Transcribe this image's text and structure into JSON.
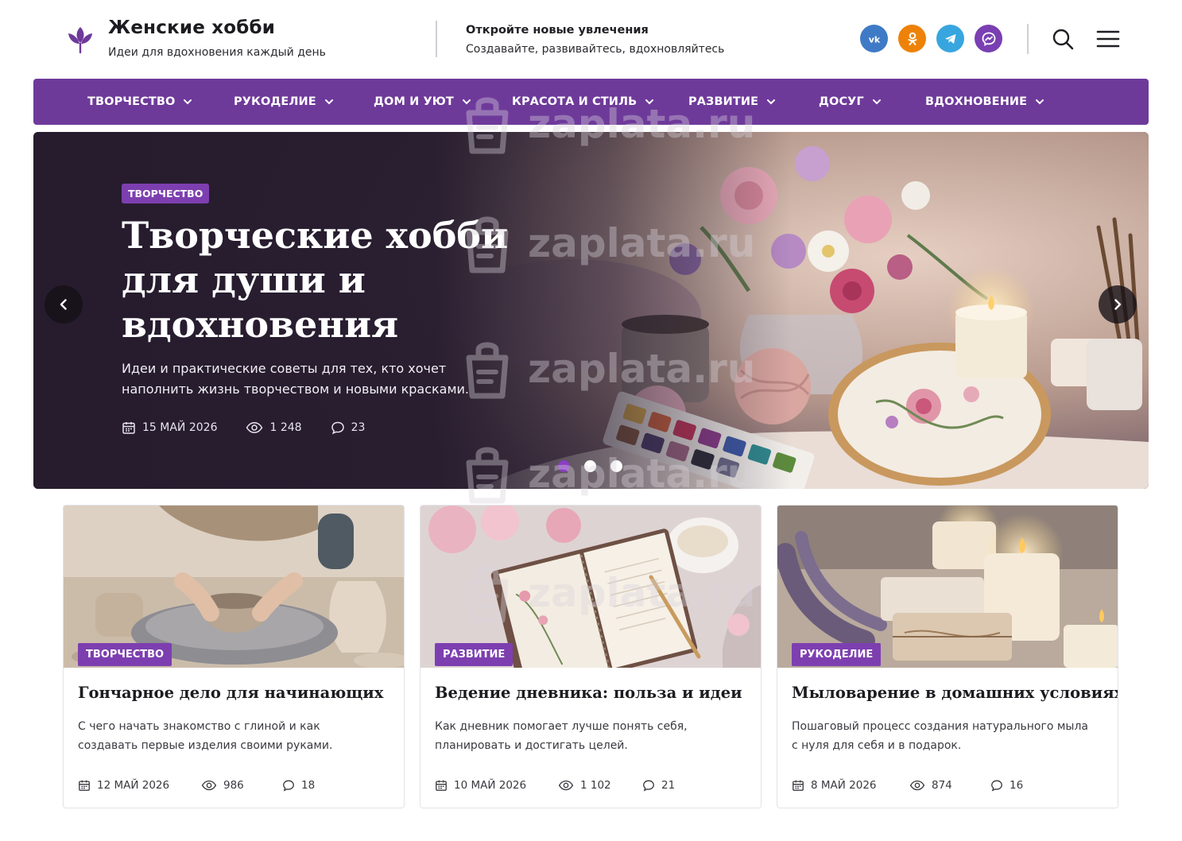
{
  "header": {
    "site_title": "Женские хобби",
    "site_subtitle": "Идеи для вдохновения каждый день",
    "tagline_title": "Откройте новые увлечения",
    "tagline_text": "Создавайте, развивайтесь, вдохновляйтесь",
    "social": [
      "vk-icon",
      "odnoklassniki-icon",
      "telegram-icon",
      "messenger-icon"
    ],
    "brand_color": "#6e3a9a"
  },
  "nav": {
    "items": [
      "ТВОРЧЕСТВО",
      "РУКОДЕЛИЕ",
      "ДОМ И УЮТ",
      "КРАСОТА И СТИЛЬ",
      "РАЗВИТИЕ",
      "ДОСУГ",
      "ВДОХНОВЕНИЕ"
    ]
  },
  "hero": {
    "badge": "ТВОРЧЕСТВО",
    "title": "Творческие хобби для души и вдохновения",
    "text": "Идеи и практические советы для тех, кто хочет наполнить жизнь творчеством и новыми красками.",
    "date": "15 МАЙ 2026",
    "views": "1 248",
    "comments": "23",
    "slides_total": 3,
    "active_slide": 1
  },
  "cards": [
    {
      "badge": "ТВОРЧЕСТВО",
      "title": "Гончарное дело для начинающих",
      "text": "С чего начать знакомство с глиной и как создавать первые изделия своими руками.",
      "date": "12 МАЙ 2026",
      "views": "986",
      "comments": "18"
    },
    {
      "badge": "РАЗВИТИЕ",
      "title": "Ведение дневника: польза и идеи",
      "text": "Как дневник помогает лучше понять себя, планировать и достигать целей.",
      "date": "10 МАЙ 2026",
      "views": "1 102",
      "comments": "21"
    },
    {
      "badge": "РУКОДЕЛИЕ",
      "title": "Мыловарение в домашних условиях",
      "text": "Пошаговый процесс создания натурального мыла с нуля для себя и в подарок.",
      "date": "8 МАЙ 2026",
      "views": "874",
      "comments": "16"
    }
  ],
  "watermark": "zaplata.ru"
}
